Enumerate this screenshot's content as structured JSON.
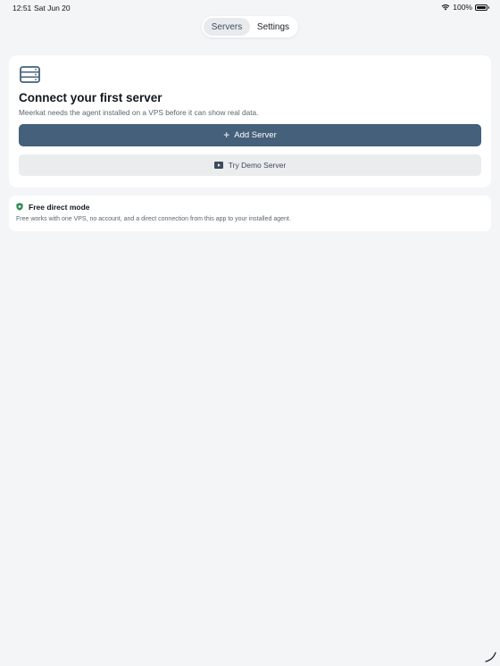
{
  "status": {
    "time": "12:51",
    "date": "Sat Jun 20",
    "battery": "100%"
  },
  "segmented": {
    "tabs": [
      {
        "label": "Servers",
        "active": true
      },
      {
        "label": "Settings",
        "active": false
      }
    ]
  },
  "empty_state": {
    "icon": "server-icon",
    "title": "Connect your first server",
    "subtitle": "Meerkat needs the agent installed on a VPS before it can show real data.",
    "add_button": "Add Server",
    "demo_button": "Try Demo Server"
  },
  "info": {
    "icon": "shield-icon",
    "title": "Free direct mode",
    "text": "Free works with one VPS, no account, and a direct connection from this app to your installed agent."
  },
  "colors": {
    "background": "#f3f5f7",
    "primary": "#44607a",
    "secondary": "#eaecee",
    "shield": "#2e8b57"
  }
}
